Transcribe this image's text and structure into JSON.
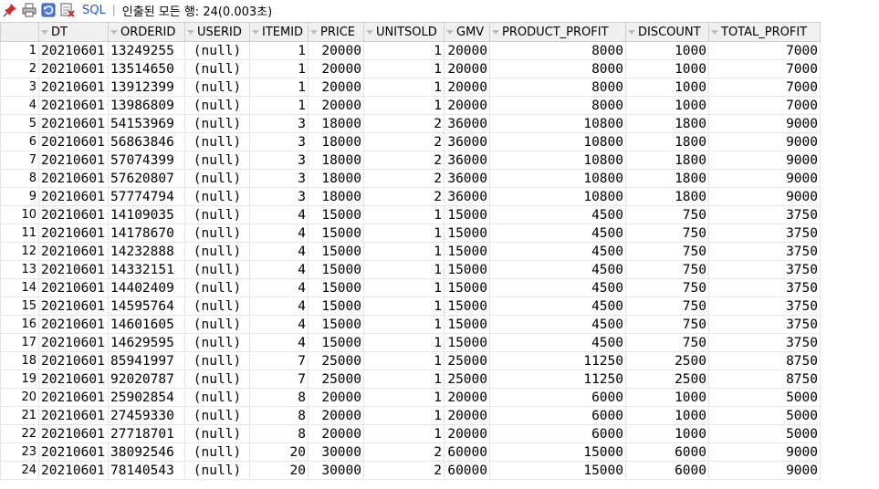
{
  "toolbar": {
    "sql_label": "SQL",
    "separator": "|",
    "status": "인출된 모든 행: 24(0.003초)"
  },
  "icons": {
    "pin": "pin-icon",
    "print": "print-icon",
    "refresh": "refresh-icon",
    "clear": "clear-icon"
  },
  "colors": {
    "sql_link": "#2a55c9",
    "header_bg": "#f0f0f0",
    "pin_red": "#d42a2a"
  },
  "grid": {
    "columns": [
      "",
      "DT",
      "ORDERID",
      "USERID",
      "ITEMID",
      "PRICE",
      "UNITSOLD",
      "GMV",
      "PRODUCT_PROFIT",
      "DISCOUNT",
      "TOTAL_PROFIT"
    ],
    "rows": [
      [
        "1",
        "20210601",
        "13249255",
        "(null)",
        "1",
        "20000",
        "1",
        "20000",
        "8000",
        "1000",
        "7000"
      ],
      [
        "2",
        "20210601",
        "13514650",
        "(null)",
        "1",
        "20000",
        "1",
        "20000",
        "8000",
        "1000",
        "7000"
      ],
      [
        "3",
        "20210601",
        "13912399",
        "(null)",
        "1",
        "20000",
        "1",
        "20000",
        "8000",
        "1000",
        "7000"
      ],
      [
        "4",
        "20210601",
        "13986809",
        "(null)",
        "1",
        "20000",
        "1",
        "20000",
        "8000",
        "1000",
        "7000"
      ],
      [
        "5",
        "20210601",
        "54153969",
        "(null)",
        "3",
        "18000",
        "2",
        "36000",
        "10800",
        "1800",
        "9000"
      ],
      [
        "6",
        "20210601",
        "56863846",
        "(null)",
        "3",
        "18000",
        "2",
        "36000",
        "10800",
        "1800",
        "9000"
      ],
      [
        "7",
        "20210601",
        "57074399",
        "(null)",
        "3",
        "18000",
        "2",
        "36000",
        "10800",
        "1800",
        "9000"
      ],
      [
        "8",
        "20210601",
        "57620807",
        "(null)",
        "3",
        "18000",
        "2",
        "36000",
        "10800",
        "1800",
        "9000"
      ],
      [
        "9",
        "20210601",
        "57774794",
        "(null)",
        "3",
        "18000",
        "2",
        "36000",
        "10800",
        "1800",
        "9000"
      ],
      [
        "10",
        "20210601",
        "14109035",
        "(null)",
        "4",
        "15000",
        "1",
        "15000",
        "4500",
        "750",
        "3750"
      ],
      [
        "11",
        "20210601",
        "14178670",
        "(null)",
        "4",
        "15000",
        "1",
        "15000",
        "4500",
        "750",
        "3750"
      ],
      [
        "12",
        "20210601",
        "14232888",
        "(null)",
        "4",
        "15000",
        "1",
        "15000",
        "4500",
        "750",
        "3750"
      ],
      [
        "13",
        "20210601",
        "14332151",
        "(null)",
        "4",
        "15000",
        "1",
        "15000",
        "4500",
        "750",
        "3750"
      ],
      [
        "14",
        "20210601",
        "14402409",
        "(null)",
        "4",
        "15000",
        "1",
        "15000",
        "4500",
        "750",
        "3750"
      ],
      [
        "15",
        "20210601",
        "14595764",
        "(null)",
        "4",
        "15000",
        "1",
        "15000",
        "4500",
        "750",
        "3750"
      ],
      [
        "16",
        "20210601",
        "14601605",
        "(null)",
        "4",
        "15000",
        "1",
        "15000",
        "4500",
        "750",
        "3750"
      ],
      [
        "17",
        "20210601",
        "14629595",
        "(null)",
        "4",
        "15000",
        "1",
        "15000",
        "4500",
        "750",
        "3750"
      ],
      [
        "18",
        "20210601",
        "85941997",
        "(null)",
        "7",
        "25000",
        "1",
        "25000",
        "11250",
        "2500",
        "8750"
      ],
      [
        "19",
        "20210601",
        "92020787",
        "(null)",
        "7",
        "25000",
        "1",
        "25000",
        "11250",
        "2500",
        "8750"
      ],
      [
        "20",
        "20210601",
        "25902854",
        "(null)",
        "8",
        "20000",
        "1",
        "20000",
        "6000",
        "1000",
        "5000"
      ],
      [
        "21",
        "20210601",
        "27459330",
        "(null)",
        "8",
        "20000",
        "1",
        "20000",
        "6000",
        "1000",
        "5000"
      ],
      [
        "22",
        "20210601",
        "27718701",
        "(null)",
        "8",
        "20000",
        "1",
        "20000",
        "6000",
        "1000",
        "5000"
      ],
      [
        "23",
        "20210601",
        "38092546",
        "(null)",
        "20",
        "30000",
        "2",
        "60000",
        "15000",
        "6000",
        "9000"
      ],
      [
        "24",
        "20210601",
        "78140543",
        "(null)",
        "20",
        "30000",
        "2",
        "60000",
        "15000",
        "6000",
        "9000"
      ]
    ]
  }
}
